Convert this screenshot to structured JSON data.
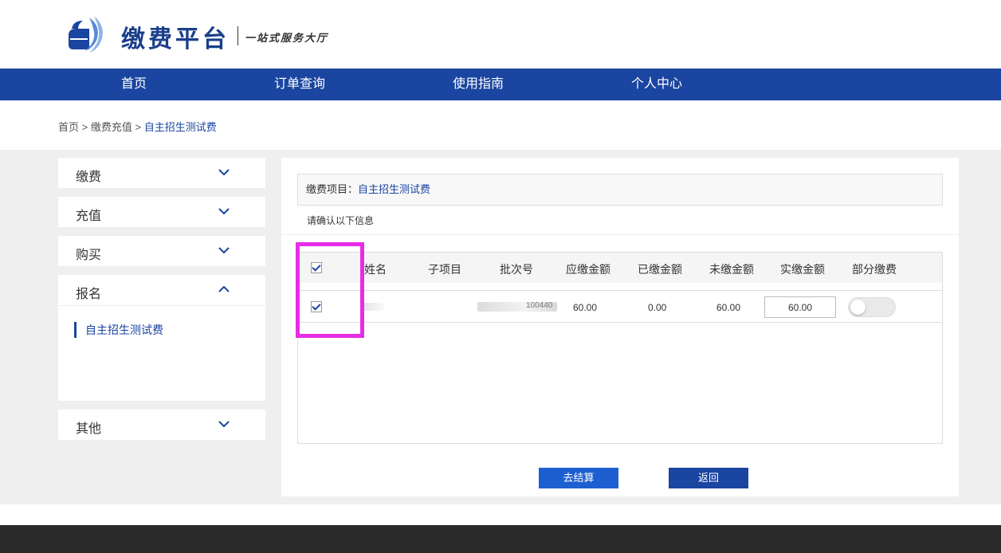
{
  "header": {
    "title": "缴费平台",
    "subtitle": "一站式服务大厅",
    "brand_color": "#1a45a0"
  },
  "nav": {
    "items": [
      {
        "label": "首页"
      },
      {
        "label": "订单查询"
      },
      {
        "label": "使用指南"
      },
      {
        "label": "个人中心"
      }
    ]
  },
  "breadcrumb": {
    "home": "首页",
    "sep": " > ",
    "parent": "缴费充值",
    "current": "自主招生测试费"
  },
  "sidebar": {
    "items": [
      {
        "label": "缴费",
        "icon": "chevron-down-icon"
      },
      {
        "label": "充值",
        "icon": "chevron-down-icon"
      },
      {
        "label": "购买",
        "icon": "chevron-down-icon"
      },
      {
        "label": "报名",
        "icon": "chevron-up-icon"
      },
      {
        "label": "其他",
        "icon": "chevron-down-icon"
      }
    ],
    "sub_items": [
      {
        "label": "自主招生测试费"
      }
    ]
  },
  "panel": {
    "project_label": "缴费项目：",
    "project_value": "自主招生测试费",
    "confirm_text": "请确认以下信息"
  },
  "table": {
    "headers": [
      "姓名",
      "子项目",
      "批次号",
      "应缴金额",
      "已缴金额",
      "未缴金额",
      "实缴金额",
      "部分缴费"
    ],
    "header_checked": true,
    "rows": [
      {
        "checked": true,
        "batch_tail": "100440",
        "due": "60.00",
        "paid": "0.00",
        "unpaid": "60.00",
        "actual": "60.00",
        "partial": false
      }
    ]
  },
  "buttons": {
    "checkout": "去结算",
    "back": "返回"
  }
}
